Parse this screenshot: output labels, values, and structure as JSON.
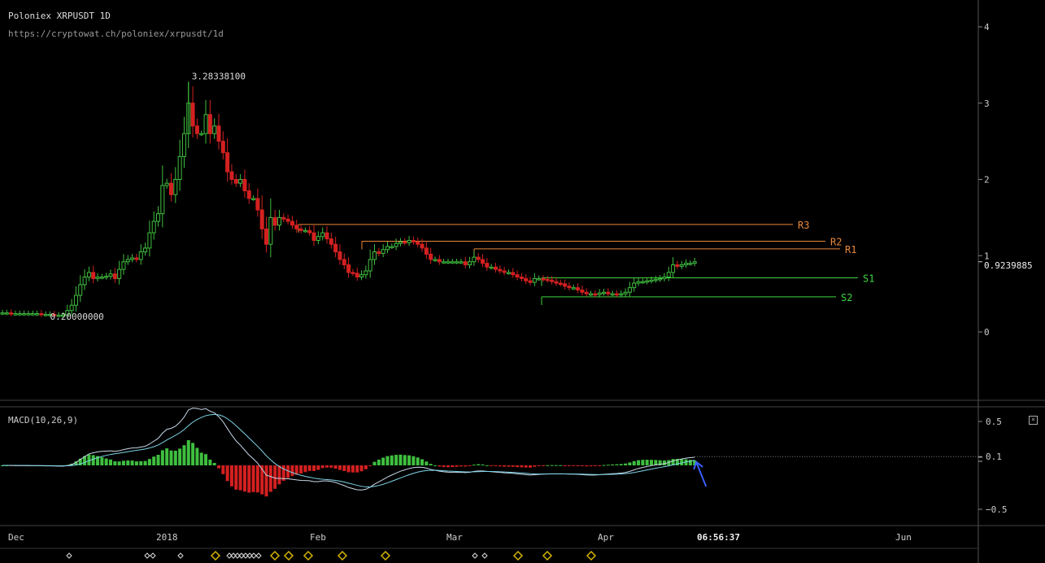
{
  "header": {
    "title": "Poloniex XRPUSDT 1D",
    "url": "https://cryptowat.ch/poloniex/xrpusdt/1d"
  },
  "macd_panel": {
    "label": "MACD(10,26,9)",
    "close_symbol": "⊠",
    "y_ticks": [
      "0.5",
      "0.1",
      "−0.5"
    ]
  },
  "time_axis": {
    "labels": [
      "Dec",
      "2018",
      "Feb",
      "Mar",
      "Apr",
      "06:56:37",
      "Jun"
    ]
  },
  "colors": {
    "up": "#3fbf3f",
    "down": "#d42020",
    "resistance": "#e8883a",
    "support": "#3ed43e",
    "macd_line": "#c8d8e8",
    "signal_line": "#7fd4e8",
    "marker": "#d4b400",
    "arrow": "#3a5fff"
  },
  "chart_data": {
    "type": "candlestick",
    "y_ticks": [
      "4",
      "3",
      "2",
      "1",
      "0"
    ],
    "ylim": [
      -0.9,
      4.3
    ],
    "last_price_label": "0.9239885",
    "high_label": "3.28338100",
    "low_label": "0.20000000",
    "levels": [
      {
        "name": "R3",
        "value": 1.41,
        "kind": "resistance"
      },
      {
        "name": "R2",
        "value": 1.19,
        "kind": "resistance"
      },
      {
        "name": "R1",
        "value": 1.09,
        "kind": "resistance"
      },
      {
        "name": "S1",
        "value": 0.71,
        "kind": "support"
      },
      {
        "name": "S2",
        "value": 0.46,
        "kind": "support"
      }
    ],
    "closes": [
      0.25,
      0.25,
      0.24,
      0.24,
      0.24,
      0.24,
      0.24,
      0.24,
      0.24,
      0.23,
      0.23,
      0.23,
      0.22,
      0.22,
      0.22,
      0.28,
      0.35,
      0.48,
      0.62,
      0.72,
      0.78,
      0.7,
      0.72,
      0.72,
      0.73,
      0.76,
      0.7,
      0.82,
      0.92,
      0.95,
      0.97,
      0.95,
      1.05,
      1.1,
      1.3,
      1.45,
      1.55,
      1.92,
      1.95,
      1.8,
      2.0,
      2.3,
      2.6,
      3.0,
      2.7,
      2.6,
      2.6,
      2.85,
      2.6,
      2.7,
      2.5,
      2.35,
      2.1,
      2.0,
      1.95,
      2.0,
      1.85,
      1.75,
      1.75,
      1.6,
      1.35,
      1.15,
      1.5,
      1.4,
      1.5,
      1.48,
      1.45,
      1.4,
      1.35,
      1.33,
      1.33,
      1.3,
      1.2,
      1.25,
      1.3,
      1.22,
      1.15,
      1.05,
      0.95,
      0.88,
      0.78,
      0.77,
      0.72,
      0.75,
      0.8,
      0.95,
      1.05,
      1.03,
      1.08,
      1.12,
      1.12,
      1.16,
      1.18,
      1.17,
      1.2,
      1.18,
      1.15,
      1.1,
      1.02,
      0.95,
      0.95,
      0.92,
      0.92,
      0.92,
      0.92,
      0.92,
      0.92,
      0.88,
      0.92,
      0.98,
      0.95,
      0.9,
      0.85,
      0.85,
      0.82,
      0.8,
      0.78,
      0.78,
      0.75,
      0.72,
      0.7,
      0.67,
      0.65,
      0.7,
      0.7,
      0.69,
      0.68,
      0.66,
      0.64,
      0.63,
      0.6,
      0.58,
      0.58,
      0.55,
      0.52,
      0.5,
      0.5,
      0.49,
      0.51,
      0.52,
      0.5,
      0.5,
      0.49,
      0.5,
      0.52,
      0.58,
      0.64,
      0.66,
      0.66,
      0.67,
      0.68,
      0.69,
      0.7,
      0.72,
      0.78,
      0.88,
      0.86,
      0.88,
      0.9,
      0.9,
      0.92
    ],
    "macd_ticks": [
      0.5,
      0.1,
      -0.5
    ],
    "macd_ylim": [
      -0.72,
      0.82
    ]
  },
  "markers": {
    "white": [
      85,
      181,
      188,
      222,
      282,
      287,
      292,
      297,
      302,
      307,
      312,
      318,
      584,
      596
    ],
    "gold": [
      265,
      338,
      355,
      379,
      421,
      474,
      637,
      673,
      727
    ]
  }
}
